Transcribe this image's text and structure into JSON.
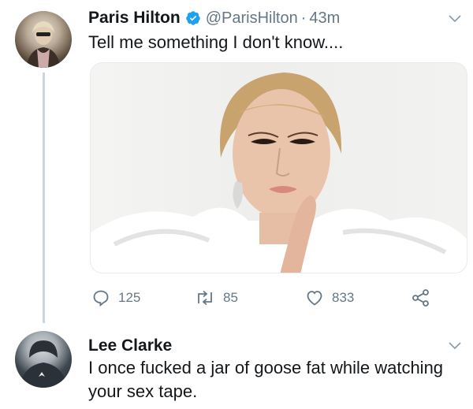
{
  "main_tweet": {
    "name": "Paris Hilton",
    "handle": "@ParisHilton",
    "separator": "·",
    "time": "43m",
    "text": "Tell me something I don't know....",
    "replies": "125",
    "retweets": "85",
    "likes": "833"
  },
  "reply_tweet": {
    "name": "Lee Clarke",
    "text": "I once fucked a jar of goose fat while watching your sex tape."
  },
  "colors": {
    "text": "#14171a",
    "secondary": "#657786",
    "verified": "#1da1f2",
    "thread_line": "#ccd6dd"
  },
  "icons": [
    "verified-badge-icon",
    "chevron-down-icon",
    "reply-icon",
    "retweet-icon",
    "like-icon",
    "share-icon"
  ]
}
